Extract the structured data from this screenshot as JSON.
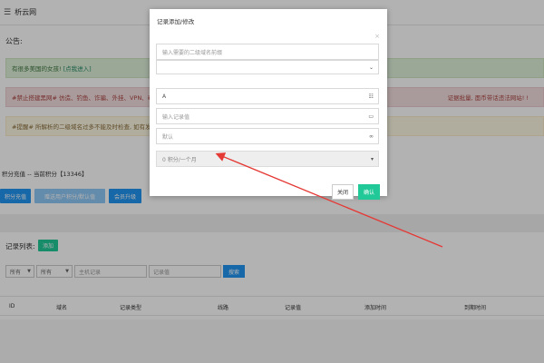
{
  "topbar": {
    "menu_icon": "☰",
    "site_name": "析云网"
  },
  "notice": {
    "title": "公告:",
    "green_text": "有很多美国的女孩!",
    "green_link": "[点我进入]",
    "red_text": "#禁止搭建黑网# 仿造、钓鱼、诈骗、外挂、VPN、毒品、",
    "red_right": "证据批量, 面币带话违法网站! !",
    "yellow_text": "#提醒# 所解析的二级域名过多不能及时检查, 如有发现再"
  },
  "credit": {
    "text": "积分充值 -- 当前积分【13346】",
    "btn_recharge": "积分充值",
    "btn_gift": "赠送用户积分/默认值",
    "btn_upgrade": "会员升级"
  },
  "records": {
    "label": "记录列表:",
    "add": "添加",
    "filter1": "所有",
    "filter2": "所有",
    "host_placeholder": "主机记录",
    "value_placeholder": "记录值",
    "search": "搜索",
    "columns": [
      "ID",
      "域名",
      "记录类型",
      "线路",
      "记录值",
      "添加时间",
      "到期时间"
    ]
  },
  "modal": {
    "title": "记录添加/修改",
    "close_x": "×",
    "subdomain_placeholder": "输入需要的二级域名前缀",
    "record_type_value": "A",
    "record_value_placeholder": "输入记录值",
    "line_value": "默认",
    "duration_value": "0 积分/一个月",
    "btn_close": "关闭",
    "btn_confirm": "确认"
  },
  "colors": {
    "accent": "#20c997",
    "primary": "#2196f3",
    "arrow": "#e53935"
  }
}
